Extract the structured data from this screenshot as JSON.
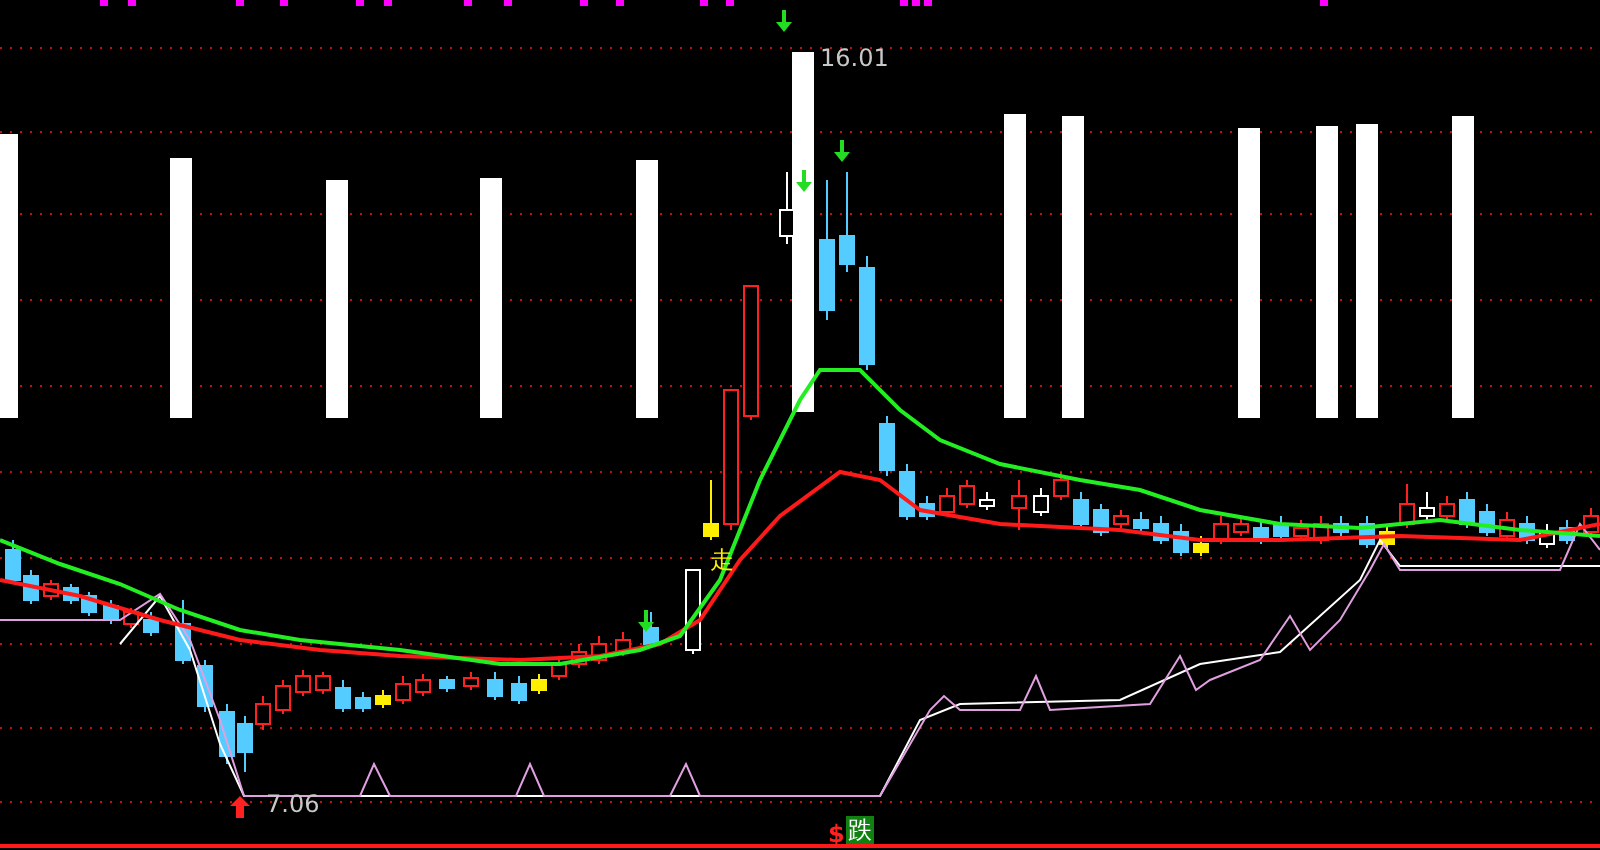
{
  "chart": {
    "high_label": "16.01",
    "low_label": "7.06",
    "signal_label": "走",
    "sell_mark": "$",
    "sell_label": "跌"
  }
}
